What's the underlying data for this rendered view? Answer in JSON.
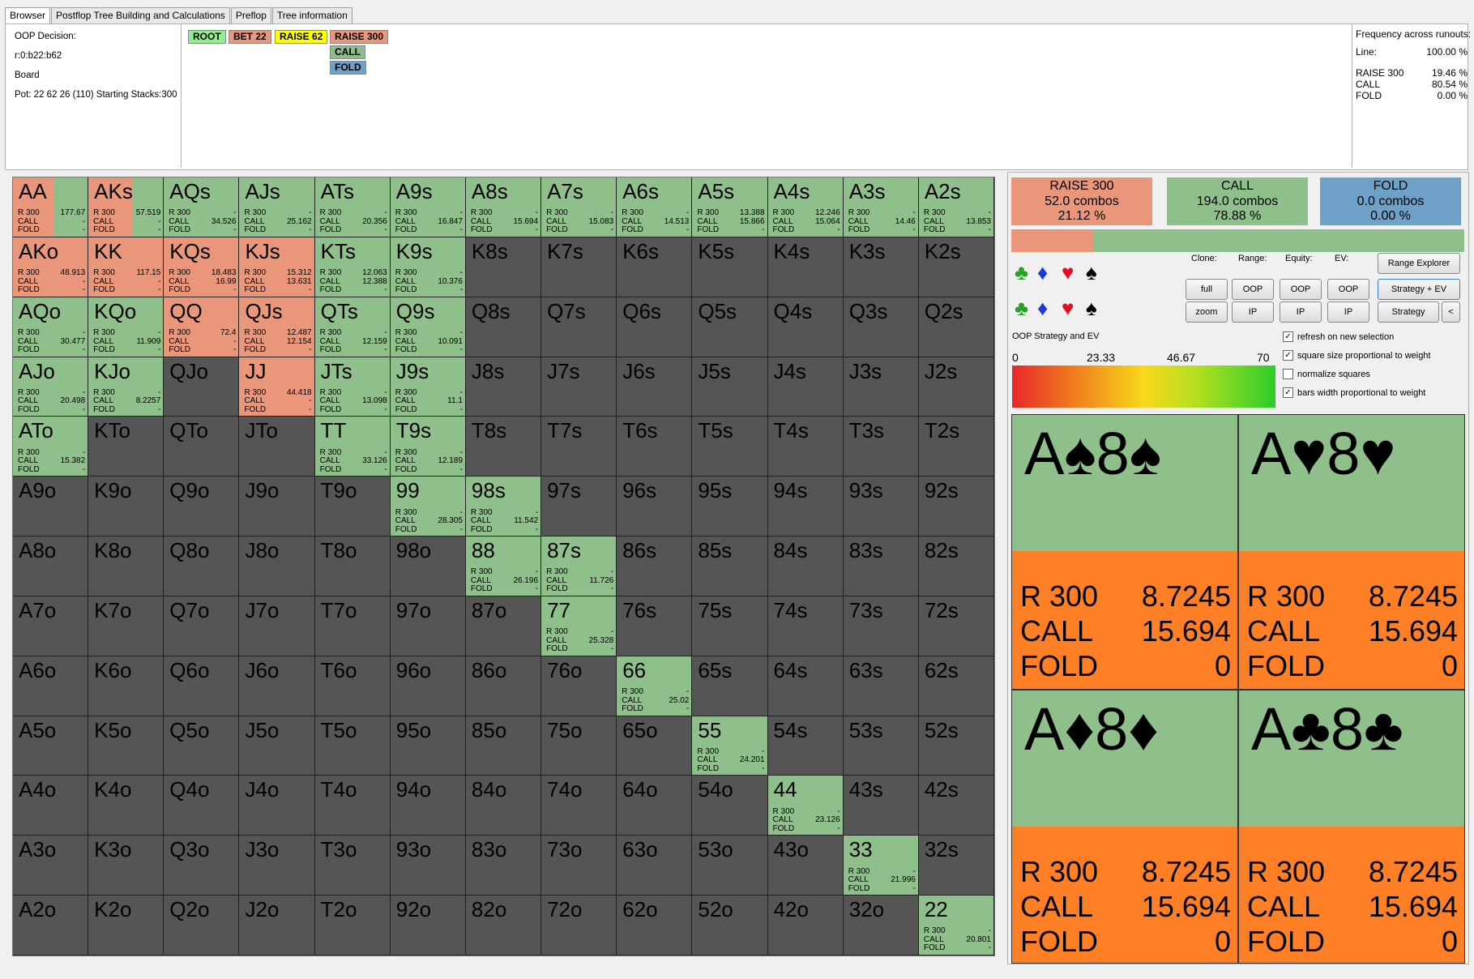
{
  "tabs": [
    "Browser",
    "Postflop Tree Building and Calculations",
    "Preflop",
    "Tree information"
  ],
  "info": {
    "decision": "OOP Decision:",
    "line": "r:0:b22:b62",
    "board": "Board",
    "pot": "Pot: 22 62 26 (110) Starting Stacks:300"
  },
  "line_nodes": [
    {
      "label": "ROOT",
      "color": "#90ee90"
    },
    {
      "label": "BET 22",
      "color": "#e9967a"
    },
    {
      "label": "RAISE 62",
      "color": "#ffff00"
    },
    {
      "label": "RAISE 300",
      "color": "#e9967a"
    },
    {
      "label": "CALL",
      "color": "#8fbc8f"
    },
    {
      "label": "FOLD",
      "color": "#6fa0c8"
    }
  ],
  "frequency": {
    "title": "Frequency across runouts:",
    "line_label": "Line:",
    "line_value": "100.00 %",
    "rows": [
      {
        "label": "RAISE 300",
        "value": "19.46 %"
      },
      {
        "label": "CALL",
        "value": "80.54 %"
      },
      {
        "label": "FOLD",
        "value": "0.00 %"
      }
    ]
  },
  "colors": {
    "raise": "#e9967a",
    "call": "#8fbf8a",
    "fold": "#6fa0c8",
    "empty": "#555555",
    "orange": "#ff7f27"
  },
  "action_labels": [
    "R 300",
    "CALL",
    "FOLD"
  ],
  "hands": [
    [
      "AA",
      "AKs",
      "AQs",
      "AJs",
      "ATs",
      "A9s",
      "A8s",
      "A7s",
      "A6s",
      "A5s",
      "A4s",
      "A3s",
      "A2s"
    ],
    [
      "AKo",
      "KK",
      "KQs",
      "KJs",
      "KTs",
      "K9s",
      "K8s",
      "K7s",
      "K6s",
      "K5s",
      "K4s",
      "K3s",
      "K2s"
    ],
    [
      "AQo",
      "KQo",
      "QQ",
      "QJs",
      "QTs",
      "Q9s",
      "Q8s",
      "Q7s",
      "Q6s",
      "Q5s",
      "Q4s",
      "Q3s",
      "Q2s"
    ],
    [
      "AJo",
      "KJo",
      "QJo",
      "JJ",
      "JTs",
      "J9s",
      "J8s",
      "J7s",
      "J6s",
      "J5s",
      "J4s",
      "J3s",
      "J2s"
    ],
    [
      "ATo",
      "KTo",
      "QTo",
      "JTo",
      "TT",
      "T9s",
      "T8s",
      "T7s",
      "T6s",
      "T5s",
      "T4s",
      "T3s",
      "T2s"
    ],
    [
      "A9o",
      "K9o",
      "Q9o",
      "J9o",
      "T9o",
      "99",
      "98s",
      "97s",
      "96s",
      "95s",
      "94s",
      "93s",
      "92s"
    ],
    [
      "A8o",
      "K8o",
      "Q8o",
      "J8o",
      "T8o",
      "98o",
      "88",
      "87s",
      "86s",
      "85s",
      "84s",
      "83s",
      "82s"
    ],
    [
      "A7o",
      "K7o",
      "Q7o",
      "J7o",
      "T7o",
      "97o",
      "87o",
      "77",
      "76s",
      "75s",
      "74s",
      "73s",
      "72s"
    ],
    [
      "A6o",
      "K6o",
      "Q6o",
      "J6o",
      "T6o",
      "96o",
      "86o",
      "76o",
      "66",
      "65s",
      "64s",
      "63s",
      "62s"
    ],
    [
      "A5o",
      "K5o",
      "Q5o",
      "J5o",
      "T5o",
      "95o",
      "85o",
      "75o",
      "65o",
      "55",
      "54s",
      "53s",
      "52s"
    ],
    [
      "A4o",
      "K4o",
      "Q4o",
      "J4o",
      "T4o",
      "94o",
      "84o",
      "74o",
      "64o",
      "54o",
      "44",
      "43s",
      "42s"
    ],
    [
      "A3o",
      "K3o",
      "Q3o",
      "J3o",
      "T3o",
      "93o",
      "83o",
      "73o",
      "63o",
      "53o",
      "43o",
      "33",
      "32s"
    ],
    [
      "A2o",
      "K2o",
      "Q2o",
      "J2o",
      "T2o",
      "92o",
      "82o",
      "72o",
      "62o",
      "52o",
      "42o",
      "32o",
      "22"
    ]
  ],
  "hand_strats": {
    "AA": {
      "raise": 0.55,
      "ev": [
        "177.67",
        "-",
        "-"
      ]
    },
    "AKs": {
      "raise": 0.6,
      "ev": [
        "57.519",
        "-",
        "-"
      ]
    },
    "AQs": {
      "raise": 0,
      "ev": [
        "-",
        "34.526",
        "-"
      ]
    },
    "AJs": {
      "raise": 0,
      "ev": [
        "-",
        "25.162",
        "-"
      ]
    },
    "ATs": {
      "raise": 0,
      "ev": [
        "-",
        "20.356",
        "-"
      ]
    },
    "A9s": {
      "raise": 0,
      "ev": [
        "-",
        "16.847",
        "-"
      ]
    },
    "A8s": {
      "raise": 0,
      "ev": [
        "-",
        "15.694",
        "-"
      ]
    },
    "A7s": {
      "raise": 0,
      "ev": [
        "-",
        "15.083",
        "-"
      ]
    },
    "A6s": {
      "raise": 0,
      "ev": [
        "-",
        "14.513",
        "-"
      ]
    },
    "A5s": {
      "raise": 0,
      "ev": [
        "13.388",
        "15.866",
        "-"
      ]
    },
    "A4s": {
      "raise": 0,
      "ev": [
        "12.246",
        "15.064",
        "-"
      ]
    },
    "A3s": {
      "raise": 0,
      "ev": [
        "-",
        "14.46",
        "-"
      ]
    },
    "A2s": {
      "raise": 0,
      "ev": [
        "-",
        "13.853",
        "-"
      ]
    },
    "AKo": {
      "raise": 1,
      "ev": [
        "48.913",
        "-",
        "-"
      ]
    },
    "KK": {
      "raise": 1,
      "ev": [
        "117.15",
        "-",
        "-"
      ]
    },
    "KQs": {
      "raise": 1,
      "ev": [
        "18.483",
        "16.99",
        "-"
      ]
    },
    "KJs": {
      "raise": 1,
      "ev": [
        "15.312",
        "13.631",
        "-"
      ]
    },
    "KTs": {
      "raise": 0,
      "ev": [
        "12.063",
        "12.388",
        "-"
      ]
    },
    "K9s": {
      "raise": 0,
      "ev": [
        "-",
        "10.376",
        "-"
      ]
    },
    "AQo": {
      "raise": 0,
      "ev": [
        "-",
        "30.477",
        "-"
      ]
    },
    "KQo": {
      "raise": 0,
      "ev": [
        "-",
        "11.909",
        "-"
      ]
    },
    "QQ": {
      "raise": 1,
      "ev": [
        "72.4",
        "-",
        "-"
      ]
    },
    "QJs": {
      "raise": 1,
      "ev": [
        "12.487",
        "12.154",
        "-"
      ]
    },
    "QTs": {
      "raise": 0,
      "ev": [
        "-",
        "12.159",
        "-"
      ]
    },
    "Q9s": {
      "raise": 0,
      "ev": [
        "-",
        "10.091",
        "-"
      ]
    },
    "AJo": {
      "raise": 0,
      "ev": [
        "-",
        "20.498",
        "-"
      ]
    },
    "KJo": {
      "raise": 0,
      "ev": [
        "-",
        "8.2257",
        "-"
      ]
    },
    "JJ": {
      "raise": 1,
      "ev": [
        "44.418",
        "-",
        "-"
      ]
    },
    "JTs": {
      "raise": 0,
      "ev": [
        "-",
        "13.098",
        "-"
      ]
    },
    "J9s": {
      "raise": 0,
      "ev": [
        "-",
        "11.1",
        "-"
      ]
    },
    "ATo": {
      "raise": 0,
      "ev": [
        "-",
        "15.382",
        "-"
      ]
    },
    "TT": {
      "raise": 0,
      "ev": [
        "-",
        "33.126",
        "-"
      ]
    },
    "T9s": {
      "raise": 0,
      "ev": [
        "-",
        "12.189",
        "-"
      ]
    },
    "99": {
      "raise": 0,
      "ev": [
        "-",
        "28.305",
        "-"
      ]
    },
    "98s": {
      "raise": 0,
      "ev": [
        "-",
        "11.542",
        "-"
      ]
    },
    "88": {
      "raise": 0,
      "ev": [
        "-",
        "26.196",
        "-"
      ]
    },
    "87s": {
      "raise": 0,
      "ev": [
        "-",
        "11.726",
        "-"
      ]
    },
    "77": {
      "raise": 0,
      "ev": [
        "-",
        "25.328",
        "-"
      ]
    },
    "66": {
      "raise": 0,
      "ev": [
        "-",
        "25.02",
        "-"
      ]
    },
    "55": {
      "raise": 0,
      "ev": [
        "-",
        "24.201",
        "-"
      ]
    },
    "44": {
      "raise": 0,
      "ev": [
        "-",
        "23.126",
        "-"
      ]
    },
    "33": {
      "raise": 0,
      "ev": [
        "-",
        "21.996",
        "-"
      ]
    },
    "22": {
      "raise": 0,
      "ev": [
        "-",
        "20.801",
        "-"
      ]
    }
  },
  "summary": [
    {
      "label": "RAISE 300",
      "combos": "52.0 combos",
      "pct": "21.12 %",
      "color": "#e9967a"
    },
    {
      "label": "CALL",
      "combos": "194.0 combos",
      "pct": "78.88 %",
      "color": "#8fbf8a"
    },
    {
      "label": "FOLD",
      "combos": "0.0 combos",
      "pct": "0.00 %",
      "color": "#6fa0c8"
    }
  ],
  "freq_bar": {
    "raise": 0.1812,
    "call": 0.8188
  },
  "controls": {
    "clone": "Clone:",
    "range": "Range:",
    "equity": "Equity:",
    "ev": "EV:",
    "range_explorer": "Range Explorer",
    "full": "full",
    "zoom": "zoom",
    "oop": "OOP",
    "ip": "IP",
    "strategy_ev": "Strategy + EV",
    "strategy": "Strategy",
    "prev": "<",
    "title": "OOP Strategy and EV",
    "scale": [
      "0",
      "23.33",
      "46.67",
      "70"
    ],
    "checks": [
      {
        "label": "refresh on new selection",
        "checked": true
      },
      {
        "label": "square size proportional to weight",
        "checked": true
      },
      {
        "label": "normalize squares",
        "checked": false
      },
      {
        "label": "bars width proportional to weight",
        "checked": true
      }
    ]
  },
  "combos": [
    {
      "name": "A♠8♠",
      "ev": [
        "8.7245",
        "15.694",
        "0"
      ]
    },
    {
      "name": "A♥8♥",
      "ev": [
        "8.7245",
        "15.694",
        "0"
      ]
    },
    {
      "name": "A♦8♦",
      "ev": [
        "8.7245",
        "15.694",
        "0"
      ]
    },
    {
      "name": "A♣8♣",
      "ev": [
        "8.7245",
        "15.694",
        "0"
      ]
    }
  ]
}
